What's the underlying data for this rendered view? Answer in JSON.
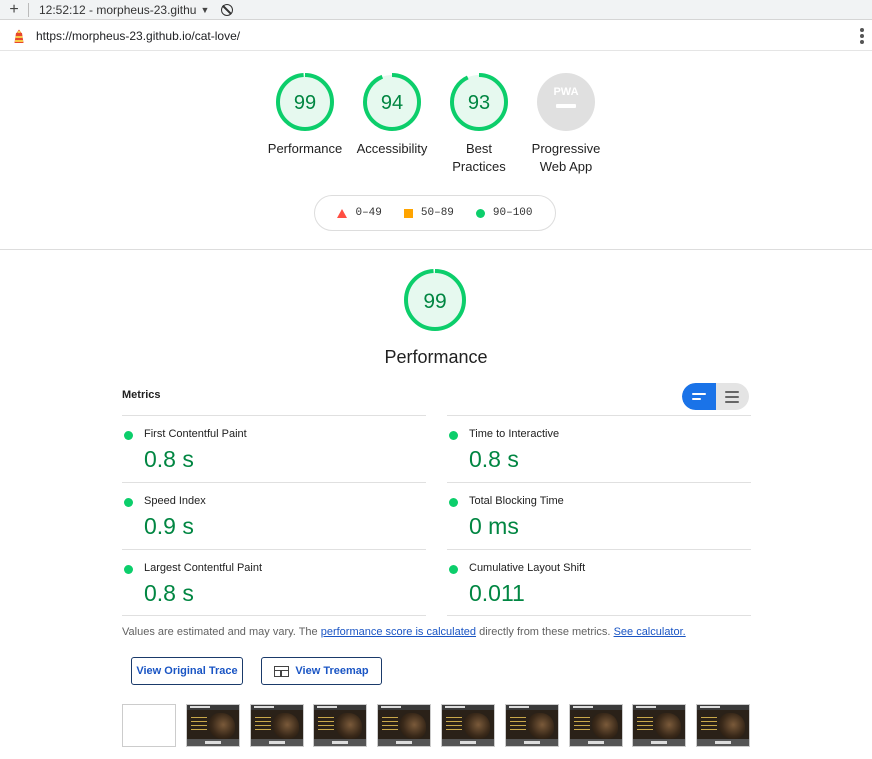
{
  "browser": {
    "tab_title": "12:52:12 - morpheus-23.githu",
    "url": "https://morpheus-23.github.io/cat-love/"
  },
  "categories": [
    {
      "name": "Performance",
      "score": "99",
      "fraction": 0.99,
      "color": "#0cce6b"
    },
    {
      "name": "Accessibility",
      "score": "94",
      "fraction": 0.94,
      "color": "#0cce6b"
    },
    {
      "name": "Best Practices",
      "score": "93",
      "fraction": 0.93,
      "color": "#0cce6b"
    },
    {
      "name": "Progressive Web App",
      "badge": "PWA",
      "color": "#9e9e9e"
    }
  ],
  "legend": [
    {
      "shape": "triangle",
      "range": "0–49",
      "color": "#ff4e42"
    },
    {
      "shape": "square",
      "range": "50–89",
      "color": "#ffa400"
    },
    {
      "shape": "circle",
      "range": "90–100",
      "color": "#0cce6b"
    }
  ],
  "performance": {
    "score": "99",
    "fraction": 0.99,
    "title": "Performance",
    "metrics_header": "Metrics",
    "metrics": [
      {
        "name": "First Contentful Paint",
        "value": "0.8 s"
      },
      {
        "name": "Time to Interactive",
        "value": "0.8 s"
      },
      {
        "name": "Speed Index",
        "value": "0.9 s"
      },
      {
        "name": "Total Blocking Time",
        "value": "0 ms"
      },
      {
        "name": "Largest Contentful Paint",
        "value": "0.8 s"
      },
      {
        "name": "Cumulative Layout Shift",
        "value": "0.011"
      }
    ],
    "note_prefix": "Values are estimated and may vary. The ",
    "note_link1": "performance score is calculated",
    "note_middle": " directly from these metrics. ",
    "note_link2": "See calculator.",
    "buttons": {
      "view_trace": "View Original Trace",
      "view_treemap": "View Treemap"
    },
    "filmstrip_frames": 10
  },
  "colors": {
    "pass": "#0cce6b",
    "pass_text": "#018642",
    "accent": "#1a73e8"
  }
}
